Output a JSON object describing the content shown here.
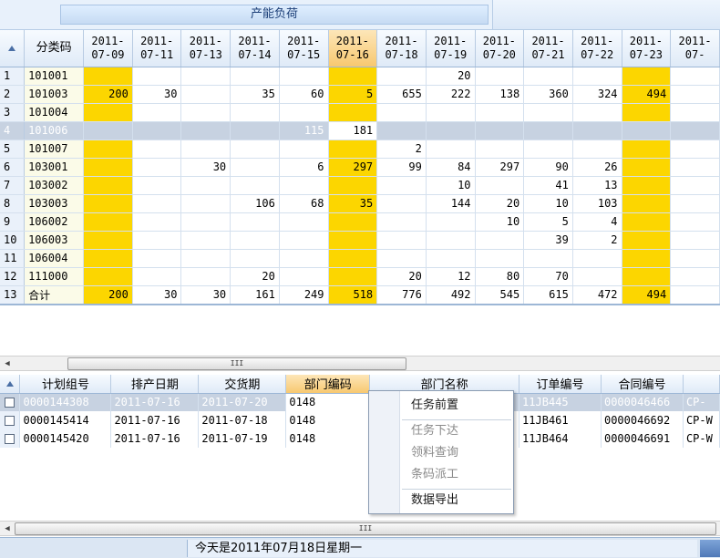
{
  "header": {
    "title": "产能负荷"
  },
  "top_grid": {
    "code_header": "分类码",
    "date_headers": [
      [
        "2011-",
        "07-09"
      ],
      [
        "2011-",
        "07-11"
      ],
      [
        "2011-",
        "07-13"
      ],
      [
        "2011-",
        "07-14"
      ],
      [
        "2011-",
        "07-15"
      ],
      [
        "2011-",
        "07-16"
      ],
      [
        "2011-",
        "07-18"
      ],
      [
        "2011-",
        "07-19"
      ],
      [
        "2011-",
        "07-20"
      ],
      [
        "2011-",
        "07-21"
      ],
      [
        "2011-",
        "07-22"
      ],
      [
        "2011-",
        "07-23"
      ],
      [
        "2011-",
        "07-"
      ]
    ],
    "selected_column": 5,
    "highlight_columns": [
      0,
      5,
      11
    ],
    "selected_row": 3,
    "rows": [
      {
        "n": "1",
        "code": "101001",
        "v": [
          "",
          "",
          "",
          "",
          "",
          "",
          "",
          "20",
          "",
          "",
          "",
          "",
          ""
        ]
      },
      {
        "n": "2",
        "code": "101003",
        "v": [
          "200",
          "30",
          "",
          "35",
          "60",
          "5",
          "655",
          "222",
          "138",
          "360",
          "324",
          "494",
          ""
        ]
      },
      {
        "n": "3",
        "code": "101004",
        "v": [
          "",
          "",
          "",
          "",
          "",
          "",
          "",
          "",
          "",
          "",
          "",
          "",
          ""
        ]
      },
      {
        "n": "4",
        "code": "101006",
        "v": [
          "",
          "",
          "",
          "",
          "115",
          "181",
          "",
          "",
          "",
          "",
          "",
          "",
          ""
        ]
      },
      {
        "n": "5",
        "code": "101007",
        "v": [
          "",
          "",
          "",
          "",
          "",
          "",
          "2",
          "",
          "",
          "",
          "",
          "",
          ""
        ]
      },
      {
        "n": "6",
        "code": "103001",
        "v": [
          "",
          "",
          "30",
          "",
          "6",
          "297",
          "99",
          "84",
          "297",
          "90",
          "26",
          "",
          ""
        ]
      },
      {
        "n": "7",
        "code": "103002",
        "v": [
          "",
          "",
          "",
          "",
          "",
          "",
          "",
          "10",
          "",
          "41",
          "13",
          "",
          ""
        ]
      },
      {
        "n": "8",
        "code": "103003",
        "v": [
          "",
          "",
          "",
          "106",
          "68",
          "35",
          "",
          "144",
          "20",
          "10",
          "103",
          "",
          ""
        ]
      },
      {
        "n": "9",
        "code": "106002",
        "v": [
          "",
          "",
          "",
          "",
          "",
          "",
          "",
          "",
          "10",
          "5",
          "4",
          "",
          ""
        ]
      },
      {
        "n": "10",
        "code": "106003",
        "v": [
          "",
          "",
          "",
          "",
          "",
          "",
          "",
          "",
          "",
          "39",
          "2",
          "",
          ""
        ]
      },
      {
        "n": "11",
        "code": "106004",
        "v": [
          "",
          "",
          "",
          "",
          "",
          "",
          "",
          "",
          "",
          "",
          "",
          "",
          ""
        ]
      },
      {
        "n": "12",
        "code": "111000",
        "v": [
          "",
          "",
          "",
          "20",
          "",
          "",
          "20",
          "12",
          "80",
          "70",
          "",
          "",
          ""
        ]
      },
      {
        "n": "13",
        "code": "合计",
        "v": [
          "200",
          "30",
          "30",
          "161",
          "249",
          "518",
          "776",
          "492",
          "545",
          "615",
          "472",
          "494",
          ""
        ]
      }
    ]
  },
  "bottom_grid": {
    "headers": [
      "计划组号",
      "排产日期",
      "交货期",
      "部门编码",
      "部门名称",
      "订单编号",
      "合同编号",
      ""
    ],
    "selected_column": 3,
    "rows": [
      {
        "c": [
          "0000144308",
          "2011-07-16",
          "2011-07-20",
          "0148",
          "",
          "11JB445",
          "0000046466",
          "CP-"
        ]
      },
      {
        "c": [
          "0000145414",
          "2011-07-16",
          "2011-07-18",
          "0148",
          "",
          "11JB461",
          "0000046692",
          "CP-W"
        ]
      },
      {
        "c": [
          "0000145420",
          "2011-07-16",
          "2011-07-19",
          "0148",
          "",
          "11JB464",
          "0000046691",
          "CP-W"
        ]
      }
    ]
  },
  "context_menu": {
    "items": [
      {
        "label": "任务前置",
        "enabled": true
      },
      {
        "label": "任务下达",
        "enabled": false
      },
      {
        "label": "领料查询",
        "enabled": false
      },
      {
        "label": "条码派工",
        "enabled": false
      },
      {
        "label": "数据导出",
        "enabled": true
      }
    ]
  },
  "scrollbar": {
    "thumb_glyph": "III"
  },
  "status": {
    "text": "今天是2011年07月18日星期一"
  }
}
